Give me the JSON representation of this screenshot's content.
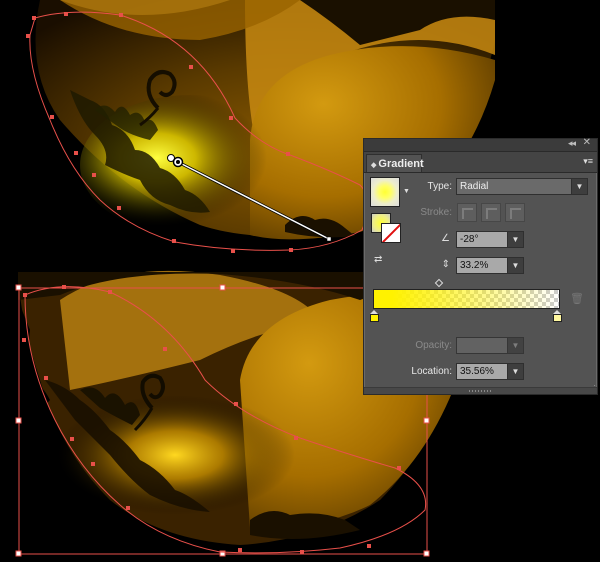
{
  "panel": {
    "tab_title": "Gradient",
    "type_label": "Type:",
    "type_value": "Radial",
    "stroke_label": "Stroke:",
    "angle_value": "-28°",
    "aspect_value": "33.2%",
    "opacity_label": "Opacity:",
    "opacity_value": "",
    "location_label": "Location:",
    "location_value": "35.56%",
    "icons": {
      "tab_arrows": "◆",
      "collapse": "◂◂",
      "close": "✕",
      "menu": "▾≡",
      "dropdown": "▼",
      "angle": "∠",
      "aspect": "⇕",
      "midpoint": "◇",
      "trash": "🗑",
      "resize": "⋰"
    },
    "gradient_stops": [
      {
        "color": "#fff200",
        "opacity": 1
      },
      {
        "color": "#fff200",
        "opacity": 0
      }
    ],
    "colors": {
      "panel_bg": "#535353",
      "accent_yellow": "#fff200",
      "path_red": "#e8504a"
    }
  }
}
